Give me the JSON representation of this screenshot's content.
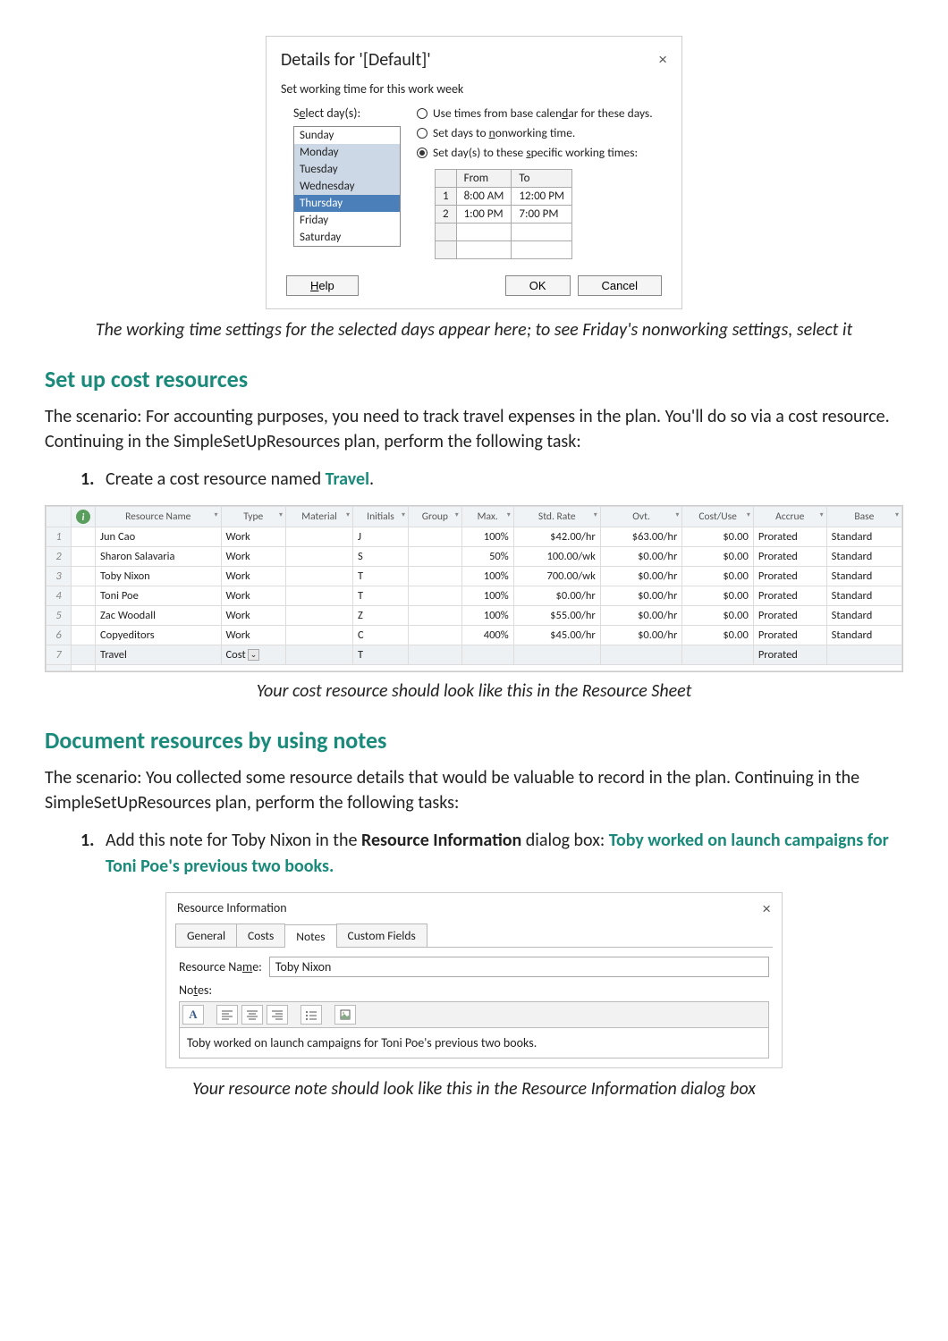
{
  "dialog1": {
    "title": "Details for '[Default]'",
    "subtitle": "Set working time for this work week",
    "select_label": "Select day(s):",
    "days": [
      "Sunday",
      "Monday",
      "Tuesday",
      "Wednesday",
      "Thursday",
      "Friday",
      "Saturday"
    ],
    "radio1": "Use times from base calendar for these days.",
    "radio2": "Set days to nonworking time.",
    "radio3": "Set day(s) to these specific working times:",
    "time_headers": [
      "",
      "From",
      "To"
    ],
    "time_rows": [
      {
        "n": "1",
        "from": "8:00 AM",
        "to": "12:00 PM"
      },
      {
        "n": "2",
        "from": "1:00 PM",
        "to": "7:00 PM"
      }
    ],
    "help": "Help",
    "ok": "OK",
    "cancel": "Cancel"
  },
  "caption1": "The working time settings for the selected days appear here; to see Friday's nonworking settings, select it",
  "heading1": "Set up cost resources",
  "para1": "The scenario: For accounting purposes, you need to track travel expenses in the plan. You'll do so via a cost resource. Continuing in the SimpleSetUpResources plan, perform the following task:",
  "step1_text": "Create a cost resource named ",
  "step1_emph": "Travel",
  "step1_period": ".",
  "res_sheet": {
    "columns": [
      "Resource Name",
      "Type",
      "Material",
      "Initials",
      "Group",
      "Max.",
      "Std. Rate",
      "Ovt.",
      "Cost/Use",
      "Accrue",
      "Base"
    ],
    "rows": [
      {
        "num": "1",
        "name": "Jun Cao",
        "type": "Work",
        "mat": "",
        "init": "J",
        "grp": "",
        "max": "100%",
        "std": "$42.00/hr",
        "ovt": "$63.00/hr",
        "cpu": "$0.00",
        "acc": "Prorated",
        "base": "Standard"
      },
      {
        "num": "2",
        "name": "Sharon Salavaria",
        "type": "Work",
        "mat": "",
        "init": "S",
        "grp": "",
        "max": "50%",
        "std": "100.00/wk",
        "ovt": "$0.00/hr",
        "cpu": "$0.00",
        "acc": "Prorated",
        "base": "Standard"
      },
      {
        "num": "3",
        "name": "Toby Nixon",
        "type": "Work",
        "mat": "",
        "init": "T",
        "grp": "",
        "max": "100%",
        "std": "700.00/wk",
        "ovt": "$0.00/hr",
        "cpu": "$0.00",
        "acc": "Prorated",
        "base": "Standard"
      },
      {
        "num": "4",
        "name": "Toni Poe",
        "type": "Work",
        "mat": "",
        "init": "T",
        "grp": "",
        "max": "100%",
        "std": "$0.00/hr",
        "ovt": "$0.00/hr",
        "cpu": "$0.00",
        "acc": "Prorated",
        "base": "Standard"
      },
      {
        "num": "5",
        "name": "Zac Woodall",
        "type": "Work",
        "mat": "",
        "init": "Z",
        "grp": "",
        "max": "100%",
        "std": "$55.00/hr",
        "ovt": "$0.00/hr",
        "cpu": "$0.00",
        "acc": "Prorated",
        "base": "Standard"
      },
      {
        "num": "6",
        "name": "Copyeditors",
        "type": "Work",
        "mat": "",
        "init": "C",
        "grp": "",
        "max": "400%",
        "std": "$45.00/hr",
        "ovt": "$0.00/hr",
        "cpu": "$0.00",
        "acc": "Prorated",
        "base": "Standard"
      },
      {
        "num": "7",
        "name": "Travel",
        "type": "Cost",
        "mat": "",
        "init": "T",
        "grp": "",
        "max": "",
        "std": "",
        "ovt": "",
        "cpu": "",
        "acc": "Prorated",
        "base": ""
      }
    ]
  },
  "caption2": "Your cost resource should look like this in the Resource Sheet",
  "heading2": "Document resources by using notes",
  "para2": "The scenario: You collected some resource details that would be valuable to record in the plan. Continuing in the SimpleSetUpResources plan, perform the following tasks:",
  "step2_a": "Add this note for Toby Nixon in the ",
  "step2_b": "Resource Information",
  "step2_c": " dialog box: ",
  "step2_d": "Toby worked on launch campaigns for Toni Poe's previous two books.",
  "dialog2": {
    "title": "Resource Information",
    "tabs": [
      "General",
      "Costs",
      "Notes",
      "Custom Fields"
    ],
    "name_label": "Resource Name:",
    "name_value": "Toby Nixon",
    "notes_label": "Notes:",
    "font_icon": "A",
    "note_text": "Toby worked on launch campaigns for Toni Poe's previous two books."
  },
  "caption3": "Your resource note should look like this in the Resource Information dialog box"
}
